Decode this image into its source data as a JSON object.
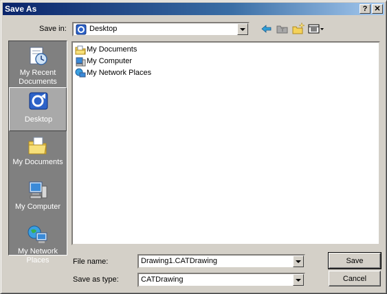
{
  "window": {
    "title": "Save As",
    "help_label": "?",
    "close_label": "✕"
  },
  "top": {
    "save_in_label": "Save in:",
    "save_in_value": "Desktop"
  },
  "toolbar": {
    "back_icon": "back-arrow-icon",
    "up_icon": "up-folder-icon",
    "new_folder_icon": "new-folder-icon",
    "view_icon": "view-menu-icon"
  },
  "places": [
    {
      "label": "My Recent Documents",
      "icon": "recent-documents-icon",
      "selected": false
    },
    {
      "label": "Desktop",
      "icon": "desktop-icon",
      "selected": true
    },
    {
      "label": "My Documents",
      "icon": "my-documents-icon",
      "selected": false
    },
    {
      "label": "My Computer",
      "icon": "my-computer-icon",
      "selected": false
    },
    {
      "label": "My Network Places",
      "icon": "network-places-icon",
      "selected": false
    }
  ],
  "files": [
    {
      "name": "My Documents",
      "icon": "folder-icon"
    },
    {
      "name": "My Computer",
      "icon": "computer-icon"
    },
    {
      "name": "My Network Places",
      "icon": "network-icon"
    }
  ],
  "bottom": {
    "file_name_label": "File name:",
    "file_name_value": "Drawing1.CATDrawing",
    "save_type_label": "Save as type:",
    "save_type_value": "CATDrawing",
    "save_button": "Save",
    "cancel_button": "Cancel"
  }
}
